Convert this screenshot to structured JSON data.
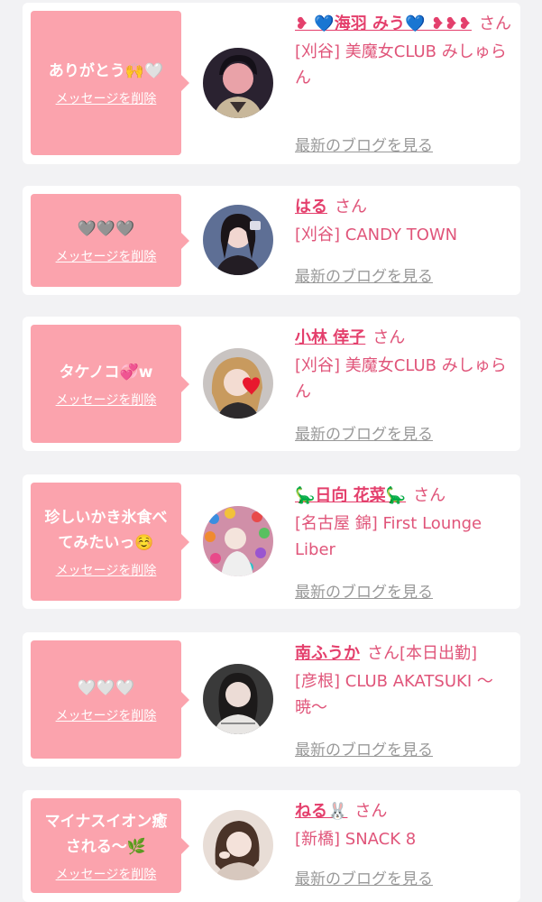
{
  "delete_label": "メッセージを削除",
  "blog_label": "最新のブログを見る",
  "san_label": "さん",
  "items": [
    {
      "message": "ありがとう🙌🤍",
      "name": "❥ 💙海羽 みう💙 ❥❥❥",
      "suffix": "さん",
      "status": "",
      "shop": "[刈谷] 美魔女CLUB みしゅらん"
    },
    {
      "message": "🩶🩶🩶",
      "name": "はる",
      "suffix": "さん",
      "status": "",
      "shop": "[刈谷] CANDY TOWN"
    },
    {
      "message": "タケノコ💞w",
      "name": "小林 倖子",
      "suffix": "さん",
      "status": "",
      "shop": "[刈谷] 美魔女CLUB みしゅらん"
    },
    {
      "message": "珍しいかき氷食べてみたいっ☺️",
      "name": "🦕日向 花菜🦕",
      "suffix": "さん",
      "status": "",
      "shop": "[名古屋 錦] First Lounge Liber"
    },
    {
      "message": "🤍🤍🤍",
      "name": "南ふうか",
      "suffix": "さん",
      "status": "[本日出勤]",
      "shop": "[彦根] CLUB AKATSUKI 〜暁〜"
    },
    {
      "message": "マイナスイオン癒される〜🌿",
      "name": "ねる🐰",
      "suffix": "さん",
      "status": "",
      "shop": "[新橋] SNACK 8"
    }
  ],
  "colors": {
    "bubble": "#fba3ad",
    "accent": "#e43f6c",
    "shop_text": "#e0557a",
    "muted": "#999999",
    "background": "#f2f2f4"
  }
}
